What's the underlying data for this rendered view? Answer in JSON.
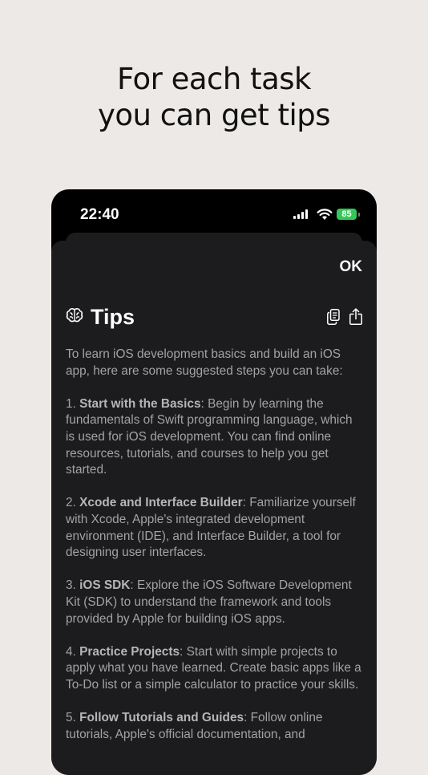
{
  "headline": {
    "line1": "For each task",
    "line2": "you can get tips"
  },
  "status_bar": {
    "time": "22:40",
    "battery_level": "85"
  },
  "sheet": {
    "ok_label": "OK",
    "title": "Tips",
    "intro": "To learn iOS development basics and build an iOS app, here are some suggested steps you can take:",
    "steps": [
      {
        "number": "1. ",
        "heading": "Start with the Basics",
        "text": ": Begin by learning the fundamentals of Swift programming language, which is used for iOS development. You can find online resources, tutorials, and courses to help you get started."
      },
      {
        "number": "2. ",
        "heading": "Xcode and Interface Builder",
        "text": ": Familiarize yourself with Xcode, Apple's integrated development environment (IDE), and Interface Builder, a tool for designing user interfaces."
      },
      {
        "number": "3. ",
        "heading": "iOS SDK",
        "text": ": Explore the iOS Software Development Kit (SDK) to understand the framework and tools provided by Apple for building iOS apps."
      },
      {
        "number": "4. ",
        "heading": "Practice Projects",
        "text": ": Start with simple projects to apply what you have learned. Create basic apps like a To-Do list or a simple calculator to practice your skills."
      },
      {
        "number": "5. ",
        "heading": "Follow Tutorials and Guides",
        "text": ": Follow online tutorials, Apple's official documentation, and"
      }
    ]
  },
  "icons": {
    "brain": "brain-icon",
    "copy": "copy-icon",
    "share": "share-icon",
    "signal": "cellular-signal-icon",
    "wifi": "wifi-icon",
    "battery": "battery-icon"
  },
  "colors": {
    "background": "#ece9e6",
    "phone": "#000000",
    "sheet": "#1c1c1e",
    "body_text": "#a2a2a7",
    "battery": "#34c759"
  }
}
